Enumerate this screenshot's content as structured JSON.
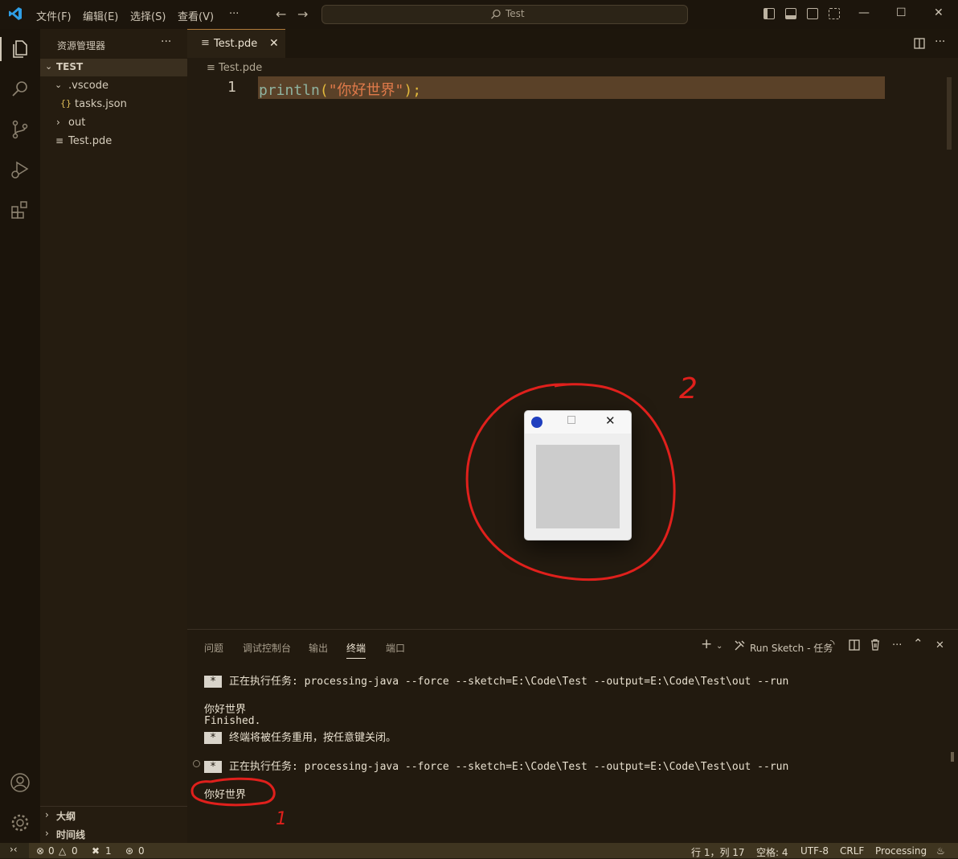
{
  "titlebar": {
    "menus": [
      "文件(F)",
      "编辑(E)",
      "选择(S)",
      "查看(V)",
      "···"
    ],
    "search_text": "Test"
  },
  "sidebar": {
    "title": "资源管理器",
    "more": "···",
    "root": "TEST",
    "items": [
      {
        "label": ".vscode"
      },
      {
        "label": "tasks.json"
      },
      {
        "label": "out"
      },
      {
        "label": "Test.pde"
      }
    ],
    "outline": "大纲",
    "timeline": "时间线"
  },
  "editor": {
    "tab_label": "Test.pde",
    "breadcrumb": "Test.pde",
    "line_number": "1",
    "code": {
      "fn": "println",
      "open": "(",
      "str": "\"你好世界\"",
      "close": ");"
    }
  },
  "panel": {
    "tabs": [
      "问题",
      "调试控制台",
      "输出",
      "终端",
      "端口"
    ],
    "task_label": "Run Sketch - 任务",
    "terminal": [
      {
        "type": "task",
        "text": "正在执行任务: processing-java --force --sketch=E:\\Code\\Test --output=E:\\Code\\Test\\out --run"
      },
      {
        "type": "plain",
        "text": "你好世界"
      },
      {
        "type": "plain",
        "text": "Finished."
      },
      {
        "type": "task",
        "text": "终端将被任务重用，按任意键关闭。"
      },
      {
        "type": "task",
        "text": "正在执行任务: processing-java --force --sketch=E:\\Code\\Test --output=E:\\Code\\Test\\out --run"
      },
      {
        "type": "plain",
        "text": "你好世界"
      }
    ],
    "star": "*"
  },
  "statusbar": {
    "errors": "0",
    "warnings": "0",
    "tools": "1",
    "ports": "0",
    "position": "行 1，列 17",
    "spaces": "空格: 4",
    "encoding": "UTF-8",
    "eol": "CRLF",
    "language": "Processing"
  },
  "annotations": {
    "label_1": "1",
    "label_2": "2"
  },
  "colors": {
    "accent": "#b07a3a",
    "annotation": "#e0201c",
    "string": "#e07a4a",
    "function": "#8fb3a0"
  }
}
